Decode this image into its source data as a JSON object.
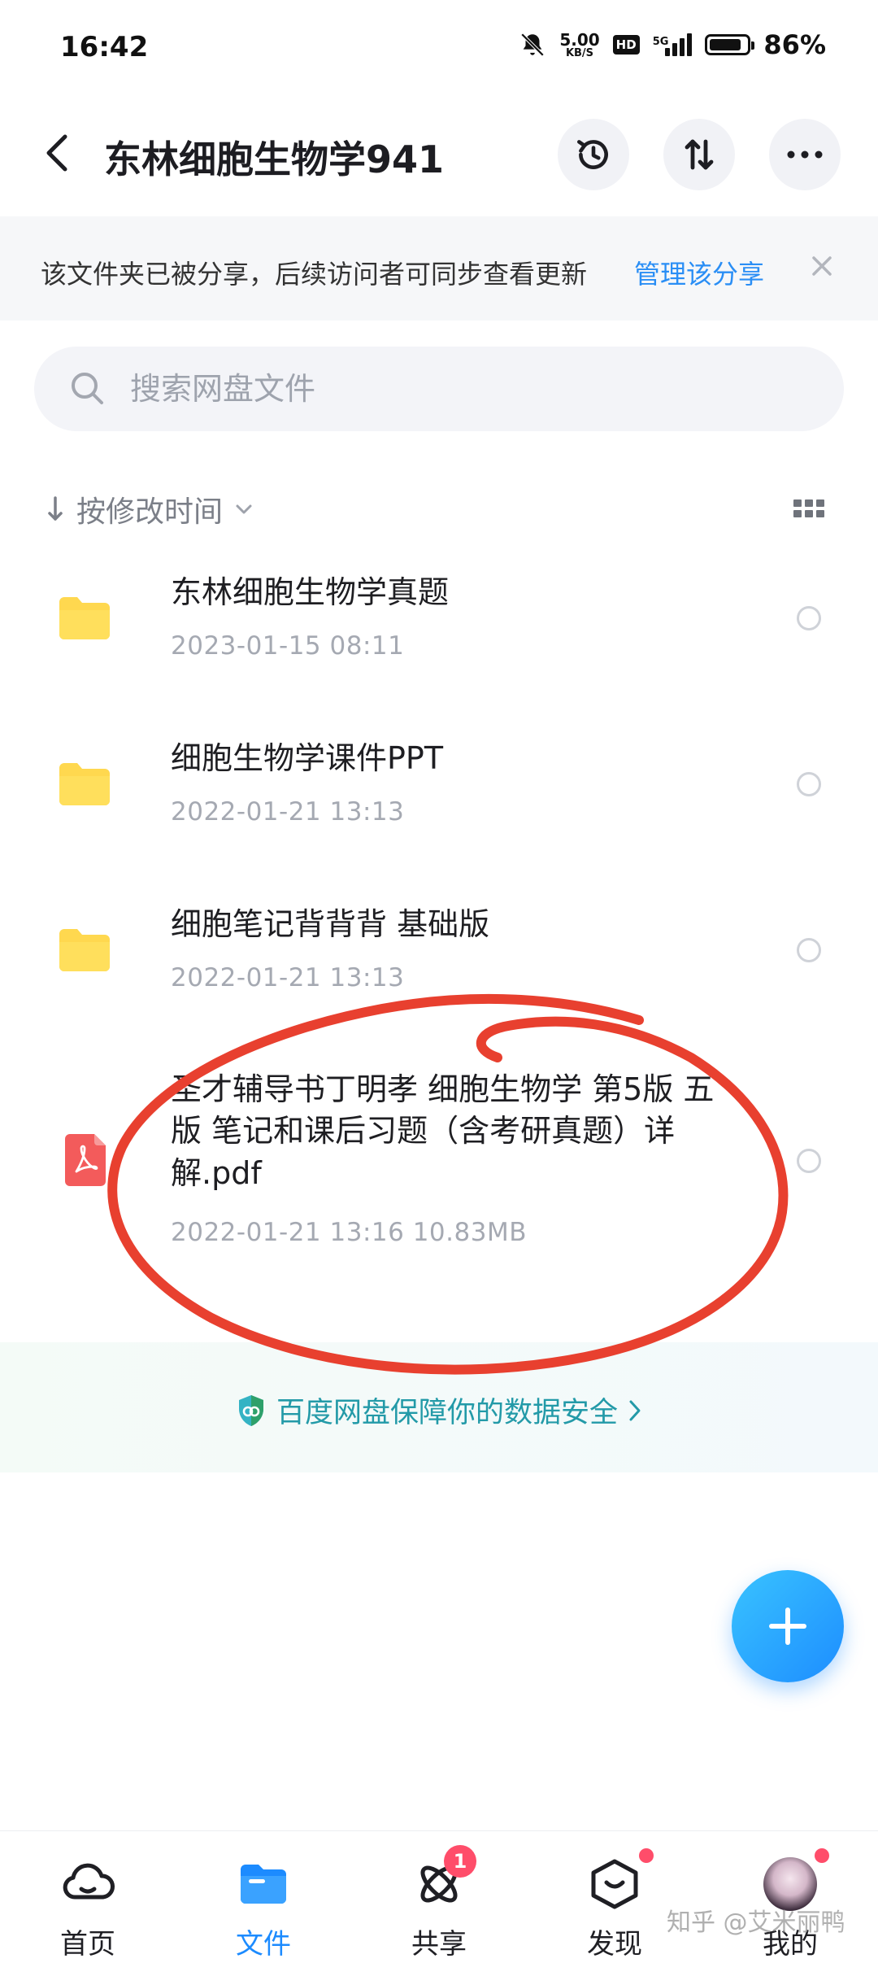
{
  "status_bar": {
    "time": "16:42",
    "net_speed_value": "5.00",
    "net_speed_unit": "KB/S",
    "hd_label": "HD",
    "signal_label": "5G",
    "battery_level": 0.86,
    "battery_text": "86%"
  },
  "header": {
    "title": "东林细胞生物学941"
  },
  "share_banner": {
    "message": "该文件夹已被分享，后续访问者可同步查看更新",
    "manage_label": "管理该分享"
  },
  "search": {
    "placeholder": "搜索网盘文件"
  },
  "sort": {
    "label": "按修改时间"
  },
  "files": [
    {
      "name": "东林细胞生物学真题",
      "type": "folder",
      "date": "2023-01-15  08:11"
    },
    {
      "name": "细胞生物学课件PPT",
      "type": "folder",
      "date": "2022-01-21  13:13"
    },
    {
      "name": "细胞笔记背背背 基础版",
      "type": "folder",
      "date": "2022-01-21  13:13"
    },
    {
      "name": "圣才辅导书丁明孝 细胞生物学 第5版 五版 笔记和课后习题（含考研真题）详解.pdf",
      "type": "pdf",
      "date": "2022-01-21  13:16   10.83MB"
    }
  ],
  "safety_notice": "百度网盘保障你的数据安全",
  "bottom_nav": [
    {
      "label": "首页",
      "icon": "cloud-home-icon",
      "active": false
    },
    {
      "label": "文件",
      "icon": "folder-icon",
      "active": true
    },
    {
      "label": "共享",
      "icon": "atom-share-icon",
      "active": false,
      "badge": "1"
    },
    {
      "label": "发现",
      "icon": "discover-box-icon",
      "active": false
    },
    {
      "label": "我的",
      "icon": "avatar",
      "active": false
    }
  ],
  "watermark": "知乎 @艾米丽鸭",
  "colors": {
    "accent": "#1c8bff",
    "link": "#2a8ef5",
    "folder": "#ffd84f",
    "pdf": "#f35b5b",
    "annotation": "#e8402f",
    "badge": "#ff4d6a"
  }
}
